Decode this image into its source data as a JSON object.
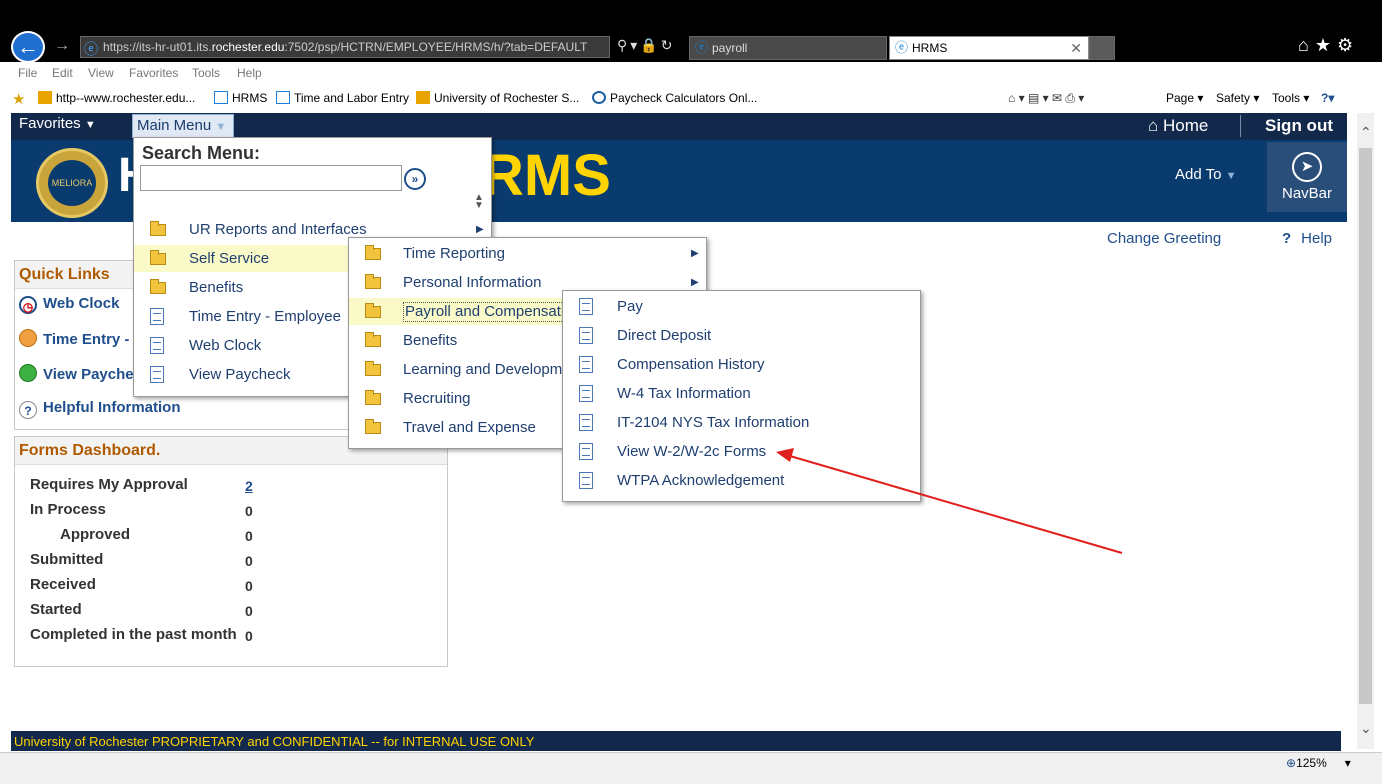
{
  "browser": {
    "url_prefix": "https://its-hr-ut01.its.",
    "url_host": "rochester.edu",
    "url_rest": ":7502/psp/HCTRN/EMPLOYEE/HRMS/h/?tab=DEFAULT",
    "tabs": [
      {
        "label": "payroll",
        "active": false
      },
      {
        "label": "HRMS",
        "active": true
      }
    ],
    "menubar": [
      "File",
      "Edit",
      "View",
      "Favorites",
      "Tools",
      "Help"
    ],
    "favorites": [
      "http--www.rochester.edu...",
      "HRMS",
      "Time and Labor Entry",
      "University of Rochester  S...",
      "Paycheck Calculators  Onl..."
    ],
    "toolbar_right": {
      "page": "Page ▾",
      "safety": "Safety ▾",
      "tools": "Tools ▾"
    },
    "zoom": "125%"
  },
  "header": {
    "favorites": "Favorites",
    "main_menu": "Main Menu",
    "home": "Home",
    "sign_out": "Sign out",
    "logo_text": "RMS",
    "logo_h": "H",
    "seal_text": "MELIORA",
    "add_to": "Add To",
    "navbar": "NavBar",
    "change_greeting": "Change Greeting",
    "help": "Help"
  },
  "search_menu": {
    "label": "Search Menu:",
    "placeholder": "",
    "items": [
      {
        "label": "UR Reports and Interfaces",
        "type": "folder",
        "submenu": true
      },
      {
        "label": "Self Service",
        "type": "folder",
        "submenu": true
      },
      {
        "label": "Benefits",
        "type": "folder",
        "submenu": false
      },
      {
        "label": "Time Entry - Employee",
        "type": "doc",
        "submenu": false
      },
      {
        "label": "Web Clock",
        "type": "doc",
        "submenu": false
      },
      {
        "label": "View Paycheck",
        "type": "doc",
        "submenu": false
      }
    ]
  },
  "self_service_menu": {
    "items": [
      {
        "label": "Time Reporting",
        "submenu": true
      },
      {
        "label": "Personal Information",
        "submenu": true
      },
      {
        "label": "Payroll and Compensati",
        "submenu": false
      },
      {
        "label": "Benefits",
        "submenu": false
      },
      {
        "label": "Learning and Developm",
        "submenu": false
      },
      {
        "label": "Recruiting",
        "submenu": false
      },
      {
        "label": "Travel and Expense",
        "submenu": false
      }
    ]
  },
  "payroll_menu": {
    "items": [
      "Pay",
      "Direct Deposit",
      "Compensation History",
      "W-4 Tax Information",
      "IT-2104 NYS Tax Information",
      "View W-2/W-2c Forms",
      "WTPA Acknowledgement"
    ]
  },
  "quick_links": {
    "title": "Quick Links",
    "items": [
      "Web Clock",
      "Time Entry -",
      "View Payche",
      "Helpful Information"
    ]
  },
  "forms_dashboard": {
    "title": "Forms Dashboard.",
    "rows": [
      {
        "label": "Requires My Approval",
        "value": "2",
        "indent": false
      },
      {
        "label": "In Process",
        "value": "0",
        "indent": false
      },
      {
        "label": "Approved",
        "value": "0",
        "indent": true
      },
      {
        "label": "Submitted",
        "value": "0",
        "indent": false
      },
      {
        "label": "Received",
        "value": "0",
        "indent": false
      },
      {
        "label": "Started",
        "value": "0",
        "indent": false
      },
      {
        "label": "Completed in the past month",
        "value": "0",
        "indent": false
      }
    ]
  },
  "footer": "University of Rochester PROPRIETARY and CONFIDENTIAL -- for INTERNAL USE ONLY",
  "colors": {
    "brand_navy": "#0a3b6e",
    "brand_gold": "#ffd400",
    "annotation_arrow": "#e0201c"
  }
}
